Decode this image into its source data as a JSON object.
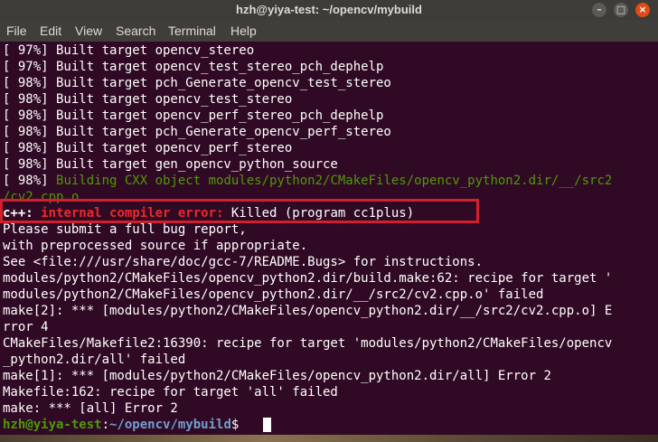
{
  "window": {
    "title": "hzh@yiya-test: ~/opencv/mybuild",
    "buttons": {
      "minimize": "–",
      "maximize": "□",
      "close": "×"
    }
  },
  "menubar": {
    "items": [
      "File",
      "Edit",
      "View",
      "Search",
      "Terminal",
      "Help"
    ]
  },
  "terminal": {
    "build_lines": [
      "[ 97%] Built target opencv_stereo",
      "[ 97%] Built target opencv_test_stereo_pch_dephelp",
      "[ 98%] Built target pch_Generate_opencv_test_stereo",
      "[ 98%] Built target opencv_test_stereo",
      "[ 98%] Built target opencv_perf_stereo_pch_dephelp",
      "[ 98%] Built target pch_Generate_opencv_perf_stereo",
      "[ 98%] Built target opencv_perf_stereo",
      "[ 98%] Built target gen_opencv_python_source"
    ],
    "building_prefix": "[ 98%] ",
    "building_text": "Building CXX object modules/python2/CMakeFiles/opencv_python2.dir/__/src2",
    "building_cont": "/cv2.cpp.o",
    "error_prefix": "c++: ",
    "error_label": "internal compiler error: ",
    "error_msg": "Killed (program cc1plus)",
    "output_lines": [
      "Please submit a full bug report,",
      "with preprocessed source if appropriate.",
      "See <file:///usr/share/doc/gcc-7/README.Bugs> for instructions.",
      "modules/python2/CMakeFiles/opencv_python2.dir/build.make:62: recipe for target '",
      "modules/python2/CMakeFiles/opencv_python2.dir/__/src2/cv2.cpp.o' failed",
      "make[2]: *** [modules/python2/CMakeFiles/opencv_python2.dir/__/src2/cv2.cpp.o] E",
      "rror 4",
      "CMakeFiles/Makefile2:16390: recipe for target 'modules/python2/CMakeFiles/opencv",
      "_python2.dir/all' failed",
      "make[1]: *** [modules/python2/CMakeFiles/opencv_python2.dir/all] Error 2",
      "Makefile:162: recipe for target 'all' failed",
      "make: *** [all] Error 2"
    ],
    "prompt_user": "hzh@yiya-test",
    "prompt_sep": ":",
    "prompt_path": "~/opencv/mybuild",
    "prompt_symbol": "$ "
  }
}
